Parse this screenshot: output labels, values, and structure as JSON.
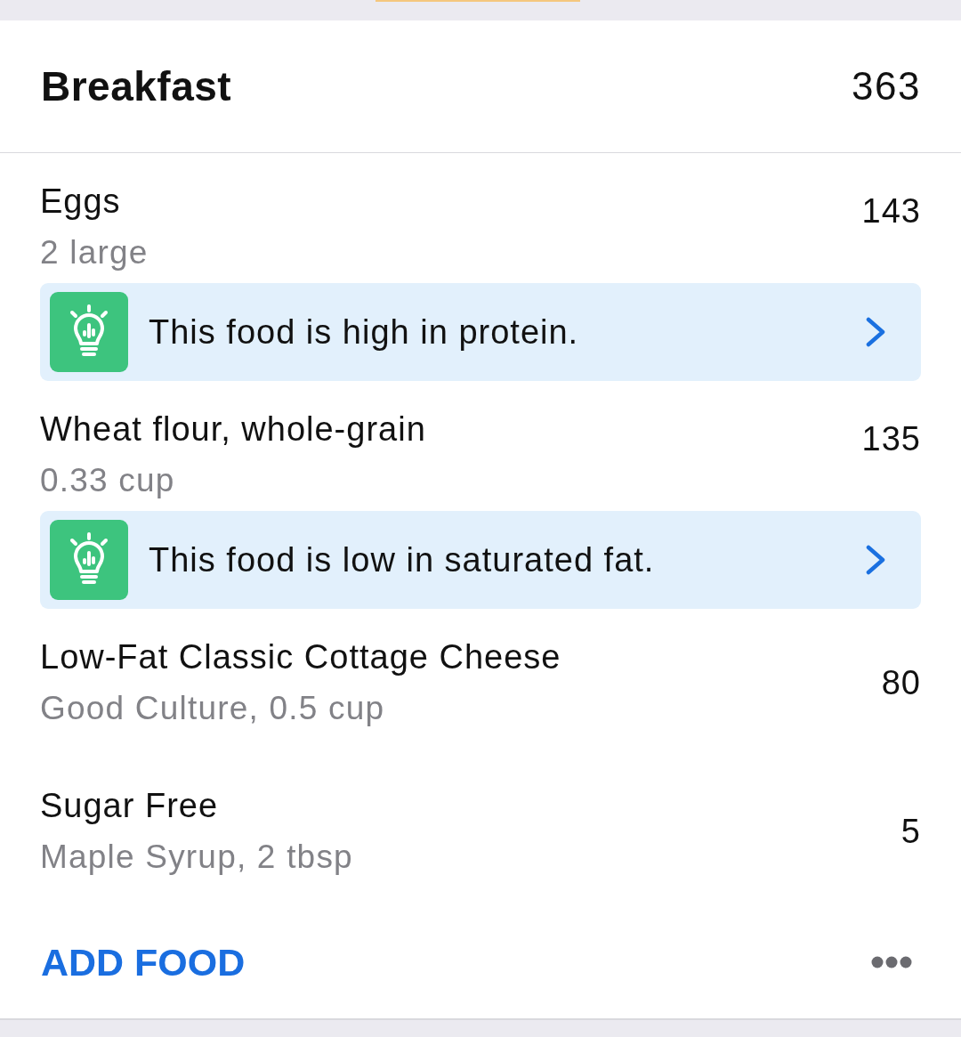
{
  "meal": {
    "title": "Breakfast",
    "calories": "363"
  },
  "foods": [
    {
      "name": "Eggs",
      "detail": "2 large",
      "calories": "143",
      "tip": {
        "text": "This food is high in protein."
      }
    },
    {
      "name": "Wheat flour, whole-grain",
      "detail": "0.33 cup",
      "calories": "135",
      "tip": {
        "text": "This food is low in saturated fat."
      }
    },
    {
      "name": "Low-Fat Classic Cottage Cheese",
      "detail": "Good Culture, 0.5 cup",
      "calories": "80"
    },
    {
      "name": "Sugar Free",
      "detail": "Maple Syrup, 2 tbsp",
      "calories": "5"
    }
  ],
  "footer": {
    "add_button": "ADD FOOD"
  }
}
